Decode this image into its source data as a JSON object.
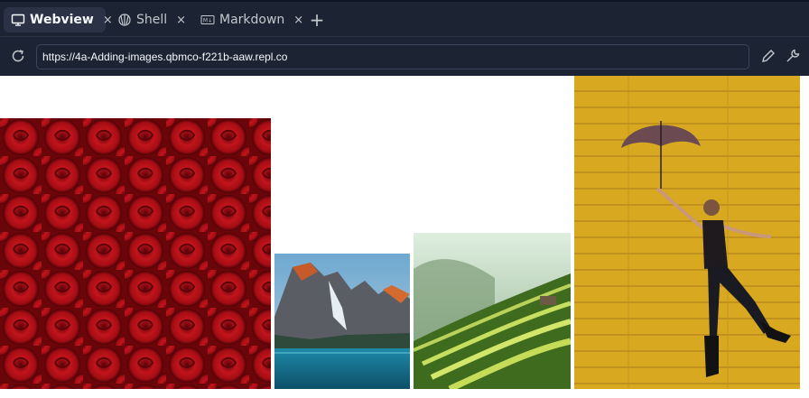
{
  "tabs": [
    {
      "label": "Webview",
      "icon": "monitor-icon",
      "active": true
    },
    {
      "label": "Shell",
      "icon": "shell-icon",
      "active": false
    },
    {
      "label": "Markdown",
      "icon": "markdown-icon",
      "active": false
    }
  ],
  "tab_close": "×",
  "new_tab": "+",
  "url": "https://4a-Adding-images.qbmco-f221b-aaw.repl.co",
  "images": [
    {
      "name": "red-roses-image",
      "subject": "red roses"
    },
    {
      "name": "mountain-lake-image",
      "subject": "mountain lake"
    },
    {
      "name": "rice-terraces-image",
      "subject": "green rice terraces"
    },
    {
      "name": "umbrella-woman-image",
      "subject": "woman with umbrella against yellow wall"
    }
  ],
  "colors": {
    "tabbar": "#1c2333",
    "active_tab": "#2b3245",
    "text": "#f5f9fc"
  }
}
